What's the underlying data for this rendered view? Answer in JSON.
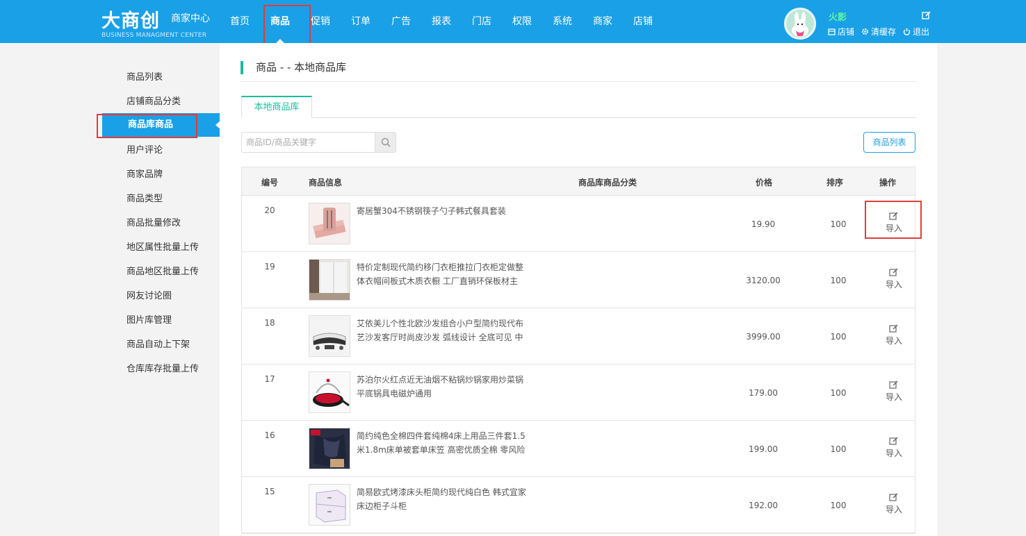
{
  "header": {
    "logo_text": "大商创",
    "logo_center": "商家中心",
    "logo_sub": "BUSINESS MANAGMENT CENTER",
    "nav": [
      "首页",
      "商品",
      "促销",
      "订单",
      "广告",
      "报表",
      "门店",
      "权限",
      "系统",
      "商家",
      "店铺"
    ],
    "active_nav": "商品",
    "user_name": "火影",
    "links": {
      "store": "店铺",
      "clear_cache": "清缓存",
      "logout": "退出"
    }
  },
  "sidebar": {
    "items": [
      "商品列表",
      "店铺商品分类",
      "商品库商品",
      "用户评论",
      "商家品牌",
      "商品类型",
      "商品批量修改",
      "地区属性批量上传",
      "商品地区批量上传",
      "网友讨论圈",
      "图片库管理",
      "商品自动上下架",
      "仓库库存批量上传"
    ],
    "active": "商品库商品"
  },
  "main": {
    "title": "商品 - - 本地商品库",
    "tab": "本地商品库",
    "search_placeholder": "商品ID/商品关键字",
    "list_button": "商品列表",
    "columns": {
      "id": "编号",
      "info": "商品信息",
      "category": "商品库商品分类",
      "price": "价格",
      "sort": "排序",
      "op": "操作"
    },
    "import_label": "导入",
    "rows": [
      {
        "id": "20",
        "name": "寄居蟹304不锈钢筷子勺子韩式餐具套装",
        "price": "19.90",
        "sort": "100"
      },
      {
        "id": "19",
        "name": "特价定制现代简约移门衣柜推拉门衣柜定做整体衣帽间板式木质衣橱 工厂直销环保板材主",
        "price": "3120.00",
        "sort": "100"
      },
      {
        "id": "18",
        "name": "艾依美儿个性北欧沙发组合小户型简约现代布艺沙发客厅时尚皮沙发 弧线设计 全底可见 中",
        "price": "3999.00",
        "sort": "100"
      },
      {
        "id": "17",
        "name": "苏泊尔火红点近无油烟不粘锅炒锅家用炒菜锅平底锅具电磁炉通用",
        "price": "179.00",
        "sort": "100"
      },
      {
        "id": "16",
        "name": "简约纯色全棉四件套纯棉4床上用品三件套1.5米1.8m床单被套单床笠 高密优质全棉 零风险",
        "price": "199.00",
        "sort": "100"
      },
      {
        "id": "15",
        "name": "简易欧式烤漆床头柜简约现代纯白色 韩式宜家床边柜子斗柜",
        "price": "192.00",
        "sort": "100"
      }
    ]
  },
  "colors": {
    "topbar": "#1aa0e6",
    "accent_green": "#1bbc9b",
    "highlight_red": "#e23b3b"
  }
}
